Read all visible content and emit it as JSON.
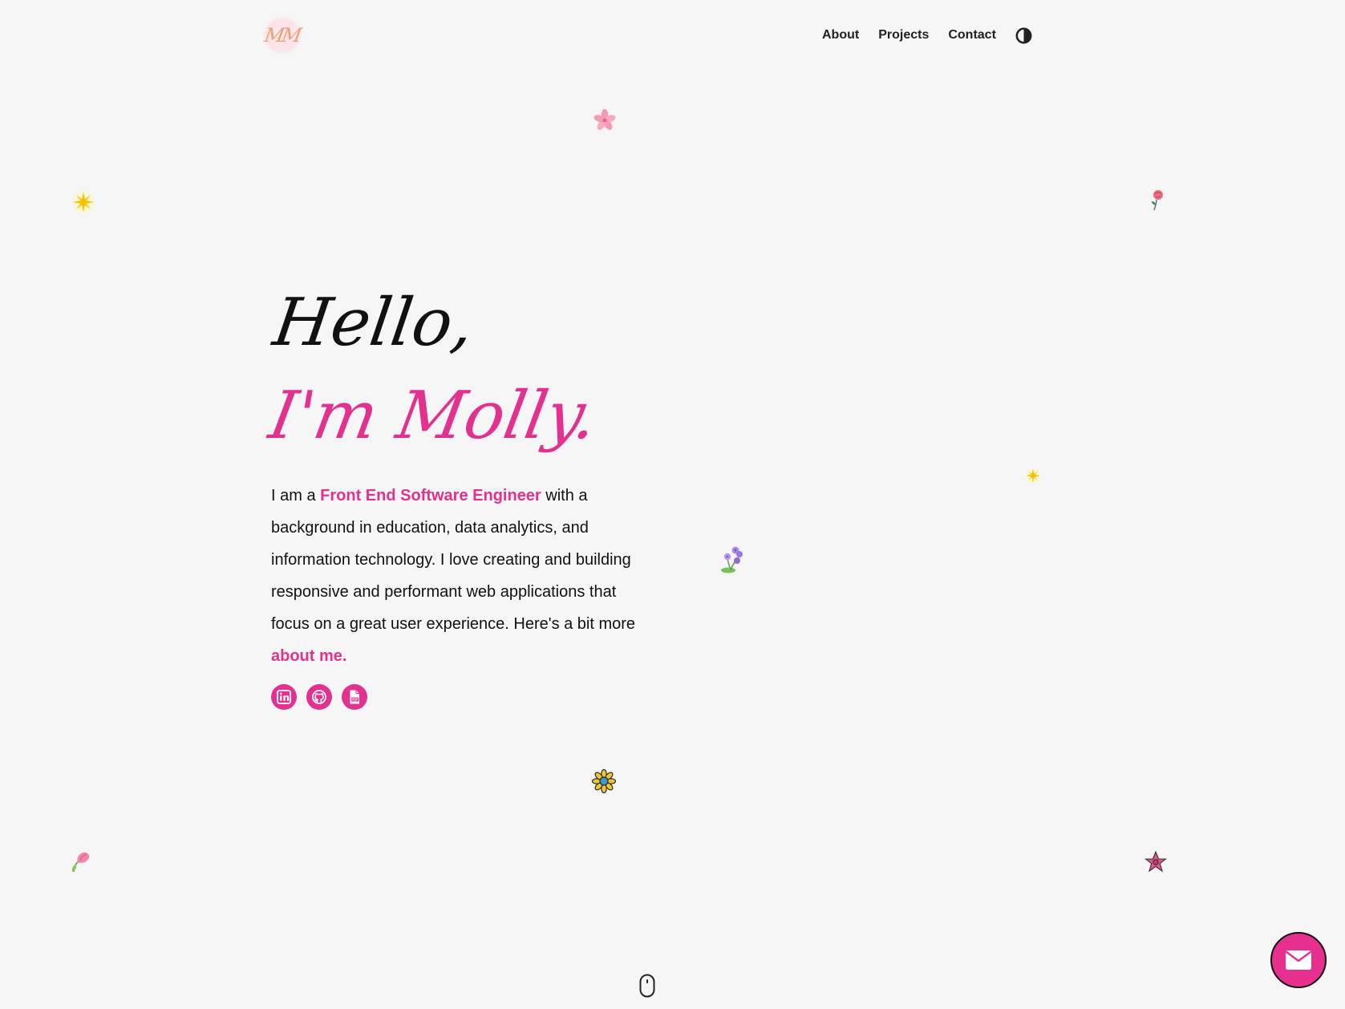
{
  "header": {
    "logo_text": "MM",
    "nav": [
      {
        "label": "About"
      },
      {
        "label": "Projects"
      },
      {
        "label": "Contact"
      }
    ],
    "theme_toggle_icon": "contrast-icon"
  },
  "hero": {
    "greeting": "Hello,",
    "name_line": "I'm Molly.",
    "intro": {
      "prefix": "I am a ",
      "role": "Front End Software Engineer",
      "body": " with a background in education, data analytics, and information technology. I love creating and building responsive and performant web applications that focus on a great user experience. Here's a bit more ",
      "about_link": "about me."
    },
    "socials": [
      {
        "icon": "linkedin-icon"
      },
      {
        "icon": "github-icon"
      },
      {
        "icon": "pdf-resume-icon"
      }
    ]
  },
  "decorations": [
    "pink-flower-icon",
    "sun-sparkle-icon",
    "rose-icon",
    "small-sparkle-icon",
    "violet-flower-icon",
    "sunflower-icon",
    "tulip-icon",
    "star-flower-icon"
  ],
  "scroll_indicator_icon": "mouse-scroll-icon",
  "contact_fab_icon": "envelope-icon",
  "colors": {
    "accent": "#e3318f",
    "background": "#f6f6f6",
    "text": "#111111"
  }
}
